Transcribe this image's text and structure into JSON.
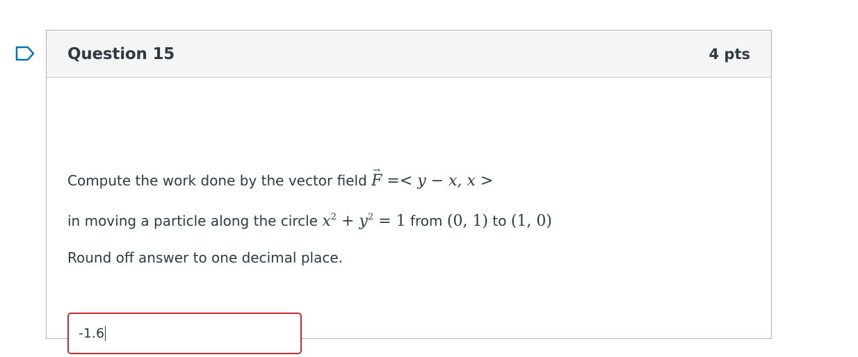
{
  "question": {
    "title": "Question 15",
    "points": "4 pts",
    "line1_prefix": "Compute the work done by the vector field ",
    "line1_math_vec": "F",
    "line1_math_rest": " =< y − x, x >",
    "line2_prefix": "in moving a particle along the circle ",
    "line2_math": "x² + y² = 1",
    "line2_from": " from ",
    "line2_point1": "(0, 1)",
    "line2_to": " to ",
    "line2_point2": "(1, 0)",
    "line3": "Round off answer to one decimal place."
  },
  "answer": {
    "value": "-1.6"
  },
  "icons": {
    "flag": "flag-outline-icon"
  },
  "colors": {
    "header_bg": "#f5f5f5",
    "text": "#2d3b45",
    "input_border_error": "#c7282e",
    "flag": "#0374b5"
  }
}
